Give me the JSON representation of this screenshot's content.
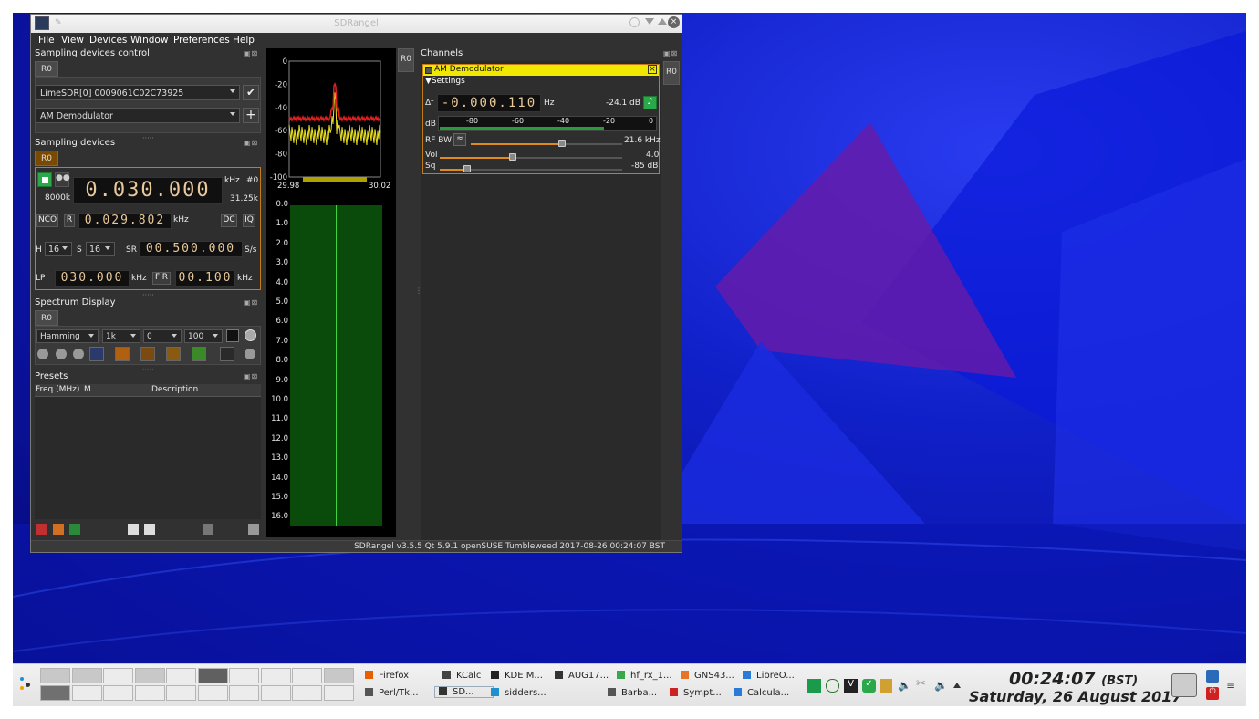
{
  "window": {
    "title": "SDRangel",
    "menu": [
      "File",
      "View",
      "Devices",
      "Window",
      "Preferences",
      "Help"
    ],
    "status_bar": "SDRangel v3.5.5 Qt 5.9.1 openSUSE Tumbleweed  2017-08-26 00:24:07 BST"
  },
  "sampling_devices_control": {
    "title": "Sampling devices control",
    "tab": "R0",
    "device_combo": "LimeSDR[0] 0009061C02C73925",
    "channel_combo": "AM Demodulator"
  },
  "sampling_devices": {
    "title": "Sampling devices",
    "tab": "R0",
    "sample_rate_label": "8000k",
    "center_freq": "0.030.000",
    "freq_unit": "kHz",
    "device_index": "#0",
    "bandwidth": "31.25k",
    "nco_label": "NCO",
    "r_label": "R",
    "nco_freq": "0.029.802",
    "nco_unit": "kHz",
    "dc_label": "DC",
    "iq_label": "IQ",
    "h_label": "H",
    "h_value": "16",
    "s_label": "S",
    "s_value": "16",
    "sr_label": "SR",
    "sr_value": "00.500.000",
    "sr_unit": "S/s",
    "lp_label": "LP",
    "lp_value": "030.000",
    "lp_unit": "kHz",
    "fir_label": "FIR",
    "fir_value": "00.100",
    "fir_unit": "kHz"
  },
  "spectrum_display": {
    "title": "Spectrum Display",
    "tab": "R0",
    "window_fn": "Hamming",
    "fft_size": "1k",
    "ref_level": "0",
    "range": "100"
  },
  "presets": {
    "title": "Presets",
    "columns": [
      "Freq (MHz)",
      "M",
      "Description"
    ]
  },
  "spectrum": {
    "y_ticks": [
      "0",
      "-20",
      "-40",
      "-60",
      "-80",
      "-100"
    ],
    "x_ticks": [
      "29.98",
      "30.02"
    ],
    "wf_ticks": [
      "0.0",
      "1.0",
      "2.0",
      "3.0",
      "4.0",
      "5.0",
      "6.0",
      "7.0",
      "8.0",
      "9.0",
      "10.0",
      "11.0",
      "12.0",
      "13.0",
      "14.0",
      "15.0",
      "16.0"
    ],
    "side_tab": "R0"
  },
  "channels": {
    "title": "Channels",
    "side_tab": "R0",
    "am": {
      "title": "AM Demodulator",
      "settings_label": "Settings",
      "delta_f_label": "Δf",
      "delta_f": "-0.000.110",
      "delta_f_unit": "Hz",
      "power": "-24.1",
      "power_unit": "dB",
      "db_label": "dB",
      "meter_ticks": [
        "-80",
        "-60",
        "-40",
        "-20",
        "0"
      ],
      "rfbw_label": "RF BW",
      "rfbw_value": "21.6 kHz",
      "rfbw_level": 0.6,
      "vol_label": "Vol",
      "vol_value": "4.0",
      "vol_level": 0.4,
      "sq_label": "Sq",
      "sq_value": "-85 dB",
      "sq_level": 0.15
    }
  },
  "taskbar": {
    "tasks": [
      {
        "label": "Firefox",
        "color": "#e66000"
      },
      {
        "label": "KCalc",
        "color": "#444444"
      },
      {
        "label": "KDE M...",
        "color": "#222222"
      },
      {
        "label": "AUG17...",
        "color": "#333333"
      },
      {
        "label": "hf_rx_1...",
        "color": "#3aa84a"
      },
      {
        "label": "GNS43...",
        "color": "#e8742a"
      },
      {
        "label": "LibreO...",
        "color": "#2a7ad6"
      },
      {
        "label": "Perl/Tk...",
        "color": "#555555"
      },
      {
        "label": "SD...",
        "color": "#333333"
      },
      {
        "label": "sidders...",
        "color": "#1e90d0"
      },
      {
        "label": "Barba...",
        "color": "#555555"
      },
      {
        "label": "Sympt...",
        "color": "#cc2222"
      },
      {
        "label": "Calcula...",
        "color": "#2a7ad6"
      }
    ],
    "clock_time": "00:24:07",
    "clock_tz": "(BST)",
    "clock_date": "Saturday, 26 August 2017"
  }
}
